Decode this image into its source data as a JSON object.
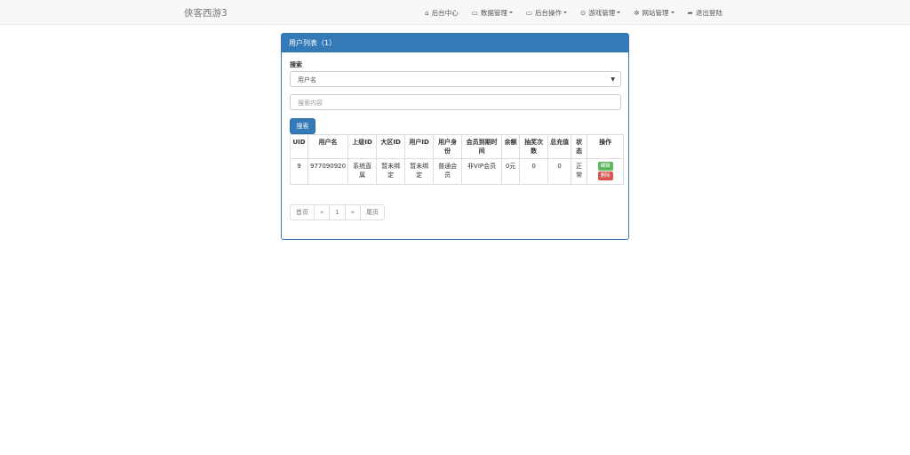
{
  "brand": "侠客西游3",
  "nav": [
    {
      "icon": "home-icon",
      "glyph": "⌂",
      "label": "后台中心",
      "dropdown": false
    },
    {
      "icon": "table-icon",
      "glyph": "▭",
      "label": "数据管理",
      "dropdown": true
    },
    {
      "icon": "table-icon",
      "glyph": "▭",
      "label": "后台操作",
      "dropdown": true
    },
    {
      "icon": "gamepad-icon",
      "glyph": "⊙",
      "label": "游戏管理",
      "dropdown": true
    },
    {
      "icon": "gear-icon",
      "glyph": "✲",
      "label": "网站管理",
      "dropdown": true
    },
    {
      "icon": "sign-out-icon",
      "glyph": "➦",
      "label": "退出登陆",
      "dropdown": false
    }
  ],
  "panel": {
    "title": "用户列表（1）",
    "search_label": "搜索",
    "select_value": "用户名",
    "input_placeholder": "搜索内容",
    "search_button": "搜索"
  },
  "table": {
    "headers": [
      "UID",
      "用户名",
      "上级ID",
      "大区ID",
      "用户ID",
      "用户身份",
      "会员到期时间",
      "余额",
      "抽奖次数",
      "总充值",
      "状态",
      "操作"
    ],
    "rows": [
      {
        "uid": "9",
        "username": "977090920",
        "parent": "系统直属",
        "zone": "暂未绑定",
        "userid": "暂未绑定",
        "identity": "普通会员",
        "expire": "非VIP会员",
        "balance": "0元",
        "draws": "0",
        "recharge": "0",
        "status": "正常",
        "edit": "编辑",
        "delete": "删除"
      }
    ]
  },
  "pagination": [
    "首页",
    "«",
    "1",
    "»",
    "尾页"
  ],
  "colors": {
    "primary": "#337ab7",
    "success": "#5cb85c",
    "danger": "#d9534f"
  }
}
